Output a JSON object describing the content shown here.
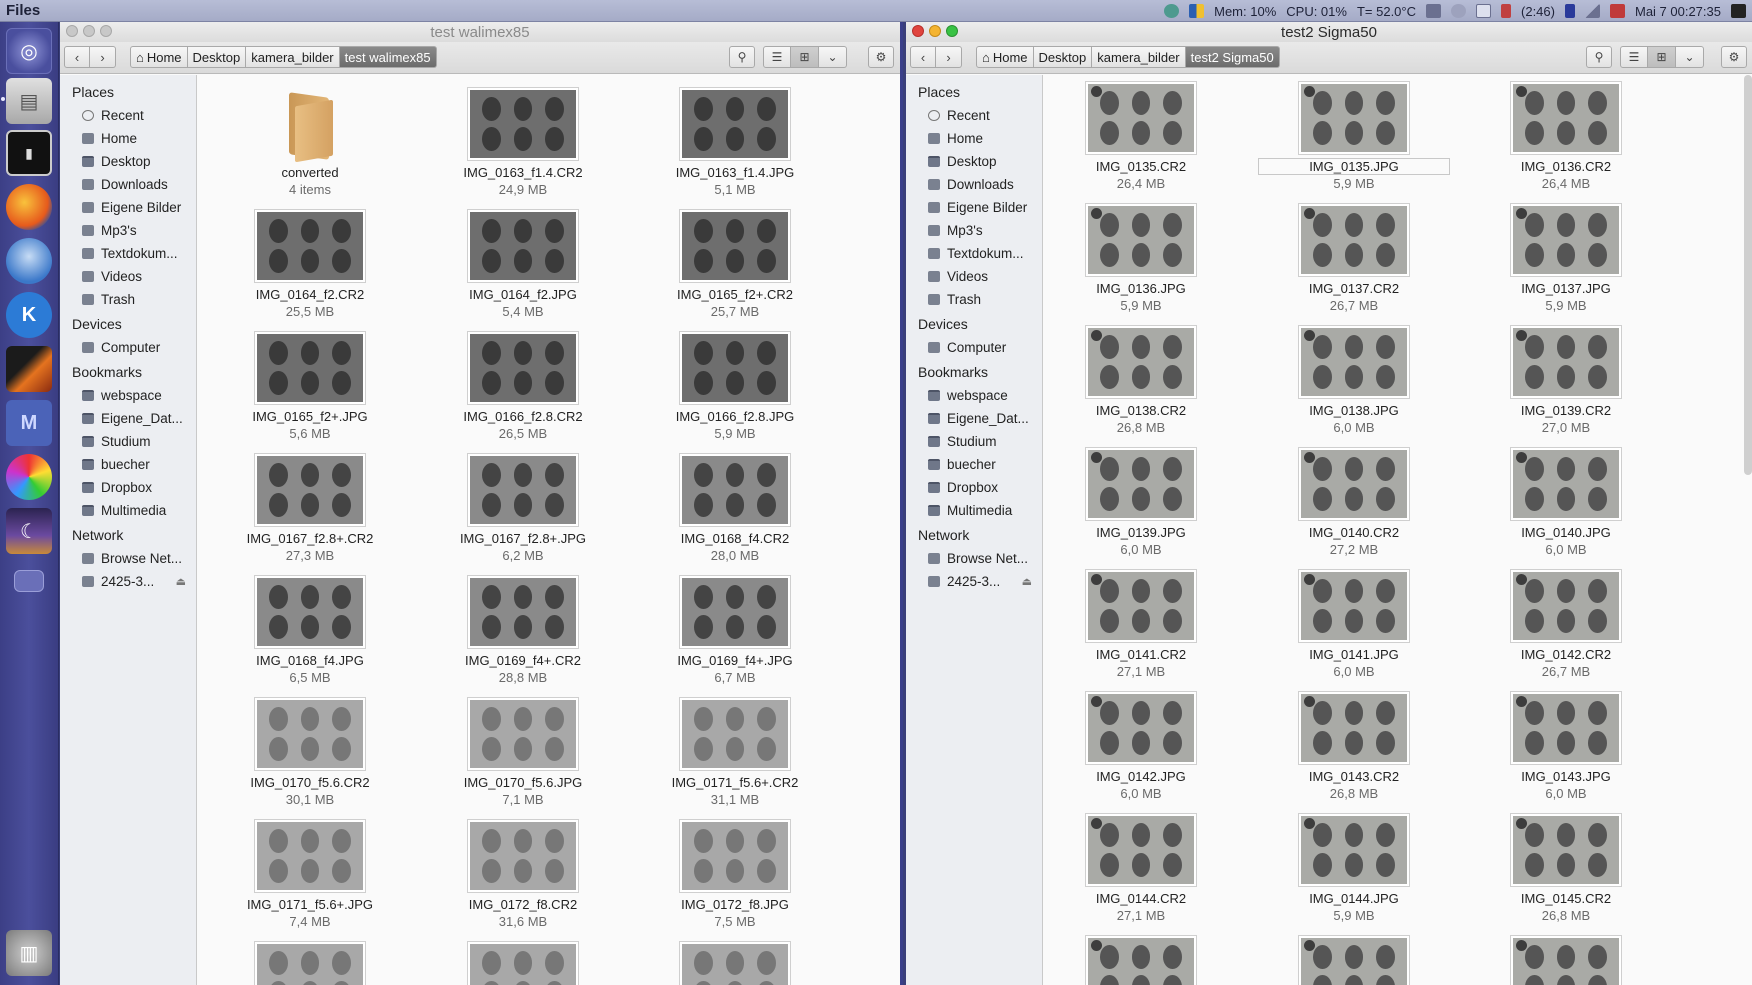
{
  "top_panel": {
    "app_name": "Files",
    "mem": "Mem: 10%",
    "cpu": "CPU: 01%",
    "temp": "T= 52.0°C",
    "battery": "(2:46)",
    "datetime": "Mai 7  00:27:35"
  },
  "launcher": {
    "items": [
      "ubuntu-home",
      "files",
      "terminal",
      "firefox",
      "thunderbird",
      "kde",
      "matlab",
      "mendeley",
      "color-picker",
      "eclipse",
      "workspace-switcher",
      "trash"
    ]
  },
  "left_window": {
    "title": "test walimex85",
    "breadcrumbs": [
      "Home",
      "Desktop",
      "kamera_bilder",
      "test walimex85"
    ],
    "files": [
      {
        "name": "converted",
        "size": "4 items",
        "type": "folder"
      },
      {
        "name": "IMG_0163_f1.4.CR2",
        "size": "24,9 MB",
        "tone": "dark"
      },
      {
        "name": "IMG_0163_f1.4.JPG",
        "size": "5,1 MB",
        "tone": "dark"
      },
      {
        "name": "IMG_0164_f2.CR2",
        "size": "25,5 MB",
        "tone": "dark"
      },
      {
        "name": "IMG_0164_f2.JPG",
        "size": "5,4 MB",
        "tone": "dark"
      },
      {
        "name": "IMG_0165_f2+.CR2",
        "size": "25,7 MB",
        "tone": "dark"
      },
      {
        "name": "IMG_0165_f2+.JPG",
        "size": "5,6 MB",
        "tone": "dark"
      },
      {
        "name": "IMG_0166_f2.8.CR2",
        "size": "26,5 MB",
        "tone": "dark"
      },
      {
        "name": "IMG_0166_f2.8.JPG",
        "size": "5,9 MB",
        "tone": "dark"
      },
      {
        "name": "IMG_0167_f2.8+.CR2",
        "size": "27,3 MB",
        "tone": "mid"
      },
      {
        "name": "IMG_0167_f2.8+.JPG",
        "size": "6,2 MB",
        "tone": "mid"
      },
      {
        "name": "IMG_0168_f4.CR2",
        "size": "28,0 MB",
        "tone": "mid"
      },
      {
        "name": "IMG_0168_f4.JPG",
        "size": "6,5 MB",
        "tone": "mid"
      },
      {
        "name": "IMG_0169_f4+.CR2",
        "size": "28,8 MB",
        "tone": "mid"
      },
      {
        "name": "IMG_0169_f4+.JPG",
        "size": "6,7 MB",
        "tone": "mid"
      },
      {
        "name": "IMG_0170_f5.6.CR2",
        "size": "30,1 MB",
        "tone": "light"
      },
      {
        "name": "IMG_0170_f5.6.JPG",
        "size": "7,1 MB",
        "tone": "light"
      },
      {
        "name": "IMG_0171_f5.6+.CR2",
        "size": "31,1 MB",
        "tone": "light"
      },
      {
        "name": "IMG_0171_f5.6+.JPG",
        "size": "7,4 MB",
        "tone": "light"
      },
      {
        "name": "IMG_0172_f8.CR2",
        "size": "31,6 MB",
        "tone": "light"
      },
      {
        "name": "IMG_0172_f8.JPG",
        "size": "7,5 MB",
        "tone": "light"
      },
      {
        "name": "",
        "size": "",
        "tone": "light"
      },
      {
        "name": "",
        "size": "",
        "tone": "light"
      },
      {
        "name": "",
        "size": "",
        "tone": "light"
      }
    ]
  },
  "right_window": {
    "title": "test2 Sigma50",
    "breadcrumbs": [
      "Home",
      "Desktop",
      "kamera_bilder",
      "test2 Sigma50"
    ],
    "files": [
      {
        "name": "IMG_0135.CR2",
        "size": "26,4 MB"
      },
      {
        "name": "IMG_0135.JPG",
        "size": "5,9 MB"
      },
      {
        "name": "IMG_0136.CR2",
        "size": "26,4 MB"
      },
      {
        "name": "IMG_0136.JPG",
        "size": "5,9 MB"
      },
      {
        "name": "IMG_0137.CR2",
        "size": "26,7 MB"
      },
      {
        "name": "IMG_0137.JPG",
        "size": "5,9 MB"
      },
      {
        "name": "IMG_0138.CR2",
        "size": "26,8 MB"
      },
      {
        "name": "IMG_0138.JPG",
        "size": "6,0 MB"
      },
      {
        "name": "IMG_0139.CR2",
        "size": "27,0 MB"
      },
      {
        "name": "IMG_0139.JPG",
        "size": "6,0 MB"
      },
      {
        "name": "IMG_0140.CR2",
        "size": "27,2 MB"
      },
      {
        "name": "IMG_0140.JPG",
        "size": "6,0 MB"
      },
      {
        "name": "IMG_0141.CR2",
        "size": "27,1 MB"
      },
      {
        "name": "IMG_0141.JPG",
        "size": "6,0 MB"
      },
      {
        "name": "IMG_0142.CR2",
        "size": "26,7 MB"
      },
      {
        "name": "IMG_0142.JPG",
        "size": "6,0 MB"
      },
      {
        "name": "IMG_0143.CR2",
        "size": "26,8 MB"
      },
      {
        "name": "IMG_0143.JPG",
        "size": "6,0 MB"
      },
      {
        "name": "IMG_0144.CR2",
        "size": "27,1 MB"
      },
      {
        "name": "IMG_0144.JPG",
        "size": "5,9 MB"
      },
      {
        "name": "IMG_0145.CR2",
        "size": "26,8 MB"
      },
      {
        "name": "",
        "size": ""
      },
      {
        "name": "",
        "size": ""
      },
      {
        "name": "",
        "size": ""
      }
    ]
  },
  "sidebar": {
    "sections": [
      {
        "heading": "Places",
        "items": [
          {
            "label": "Recent",
            "icon": "clock-icon"
          },
          {
            "label": "Home",
            "icon": "home-icon"
          },
          {
            "label": "Desktop",
            "icon": "folder-icon"
          },
          {
            "label": "Downloads",
            "icon": "download-icon"
          },
          {
            "label": "Eigene Bilder",
            "icon": "camera-icon"
          },
          {
            "label": "Mp3's",
            "icon": "music-icon"
          },
          {
            "label": "Textdokum...",
            "icon": "document-icon"
          },
          {
            "label": "Videos",
            "icon": "film-icon"
          },
          {
            "label": "Trash",
            "icon": "trash-icon"
          }
        ]
      },
      {
        "heading": "Devices",
        "items": [
          {
            "label": "Computer",
            "icon": "computer-icon"
          }
        ]
      },
      {
        "heading": "Bookmarks",
        "items": [
          {
            "label": "webspace",
            "icon": "folder-icon"
          },
          {
            "label": "Eigene_Dat...",
            "icon": "folder-icon"
          },
          {
            "label": "Studium",
            "icon": "folder-icon"
          },
          {
            "label": "buecher",
            "icon": "folder-icon"
          },
          {
            "label": "Dropbox",
            "icon": "folder-icon"
          },
          {
            "label": "Multimedia",
            "icon": "folder-icon"
          }
        ]
      },
      {
        "heading": "Network",
        "items": [
          {
            "label": "Browse Net...",
            "icon": "network-icon"
          },
          {
            "label": "2425-3...",
            "icon": "drive-icon",
            "eject": true
          }
        ]
      }
    ]
  }
}
